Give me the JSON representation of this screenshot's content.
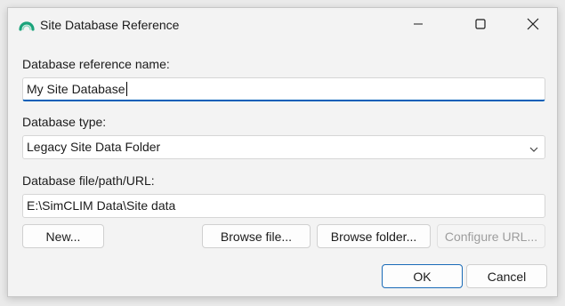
{
  "window": {
    "title": "Site Database Reference",
    "icon": "app-arc-icon",
    "minimize_icon": "minimize-icon",
    "maximize_icon": "maximize-icon",
    "close_icon": "close-icon"
  },
  "form": {
    "name_label": "Database reference name:",
    "name_value": "My Site Database",
    "type_label": "Database type:",
    "type_selected": "Legacy Site Data Folder",
    "path_label": "Database file/path/URL:",
    "path_value": "E:\\SimCLIM Data\\Site data"
  },
  "buttons": {
    "new": "New...",
    "browse_file": "Browse file...",
    "browse_folder": "Browse folder...",
    "configure_url": "Configure URL...",
    "ok": "OK",
    "cancel": "Cancel"
  },
  "colors": {
    "accent": "#005fb8",
    "icon_teal": "#1aa37a"
  }
}
